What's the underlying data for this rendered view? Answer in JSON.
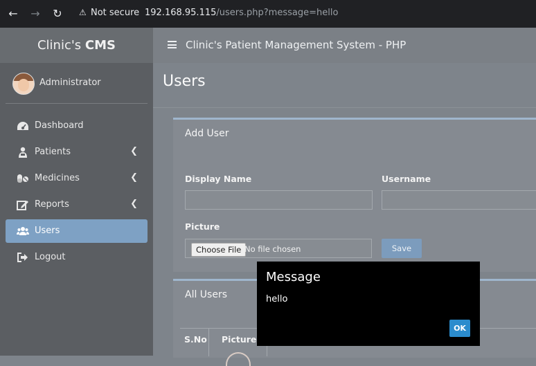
{
  "browser": {
    "back_icon": "←",
    "forward_icon": "→",
    "reload_icon": "↻",
    "security_icon": "⚠",
    "security_label": "Not secure",
    "url_host": "192.168.95.115",
    "url_path": "/users.php?message=hello"
  },
  "sidebar": {
    "brand_prefix": "Clinic's ",
    "brand_bold": "CMS",
    "user_name": "Administrator",
    "items": [
      {
        "label": "Dashboard",
        "icon": "dashboard-icon",
        "has_submenu": false,
        "active": false
      },
      {
        "label": "Patients",
        "icon": "patient-icon",
        "has_submenu": true,
        "active": false
      },
      {
        "label": "Medicines",
        "icon": "pills-icon",
        "has_submenu": true,
        "active": false
      },
      {
        "label": "Reports",
        "icon": "edit-icon",
        "has_submenu": true,
        "active": false
      },
      {
        "label": "Users",
        "icon": "users-icon",
        "has_submenu": false,
        "active": true
      },
      {
        "label": "Logout",
        "icon": "logout-icon",
        "has_submenu": false,
        "active": false
      }
    ],
    "chevron": "❮"
  },
  "header": {
    "title": "Clinic's Patient Management System - PHP"
  },
  "page": {
    "title": "Users"
  },
  "add_user": {
    "title": "Add User",
    "display_name_label": "Display Name",
    "display_name_value": "",
    "username_label": "Username",
    "username_value": "",
    "picture_label": "Picture",
    "choose_file_label": "Choose File",
    "file_status": "No file chosen",
    "save_label": "Save"
  },
  "all_users": {
    "title": "All Users",
    "columns": [
      "S.No",
      "Picture"
    ]
  },
  "dialog": {
    "title": "Message",
    "message": "hello",
    "ok_label": "OK"
  },
  "colors": {
    "active_menu": "#7ea1c4",
    "ok_button": "#2b8ccd",
    "card_border": "#9fb6cd"
  }
}
